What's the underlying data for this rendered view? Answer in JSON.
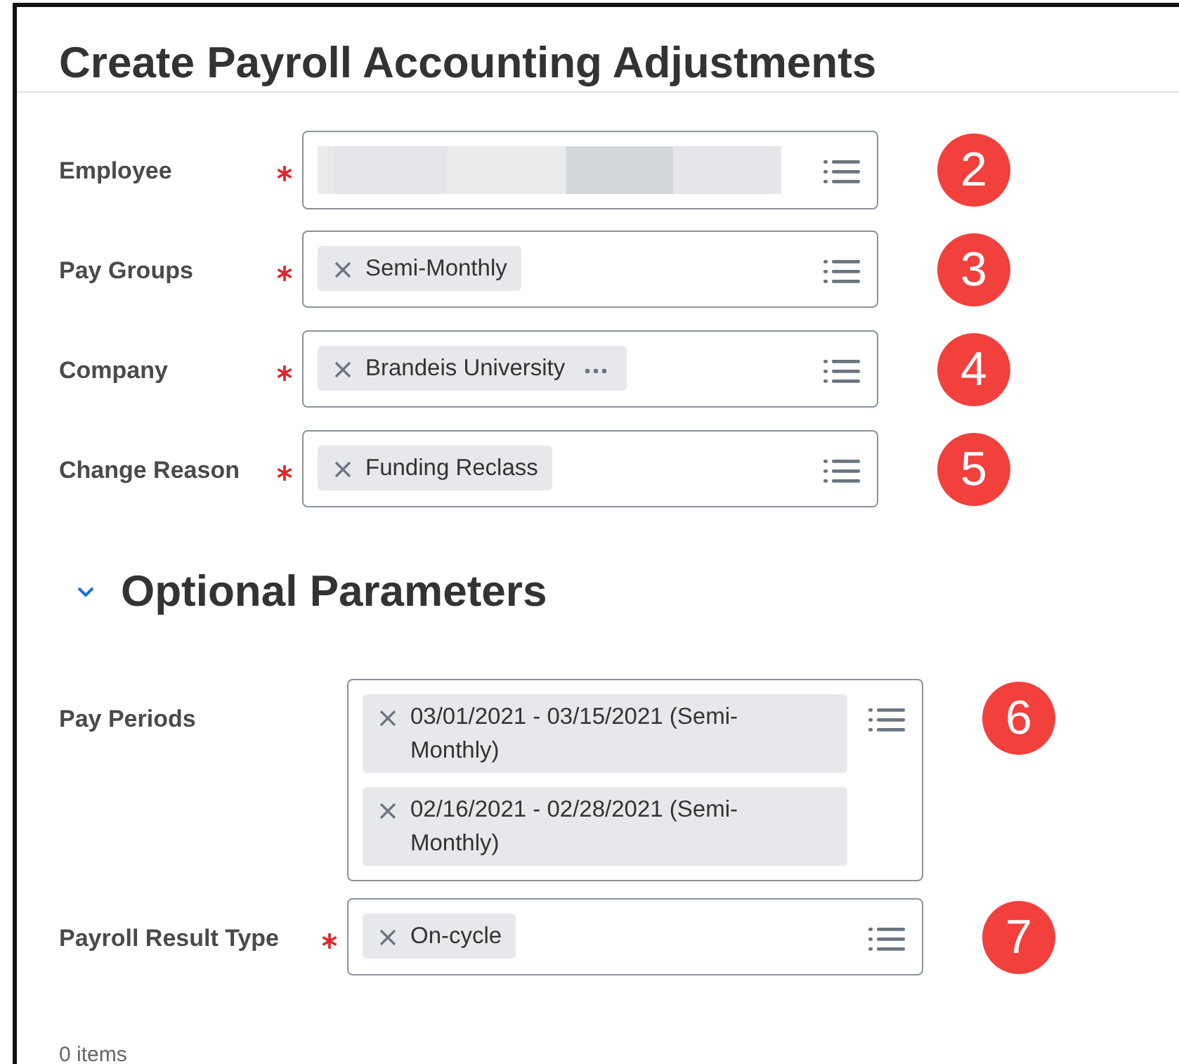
{
  "title": "Create Payroll Accounting Adjustments",
  "fields": [
    {
      "label": "Employee",
      "required": true,
      "kind": "redacted",
      "badge": "2"
    },
    {
      "label": "Pay Groups",
      "required": true,
      "kind": "chips",
      "chips": [
        {
          "text": "Semi-Monthly",
          "related_actions": false
        }
      ],
      "badge": "3"
    },
    {
      "label": "Company",
      "required": true,
      "kind": "chips",
      "chips": [
        {
          "text": "Brandeis University",
          "related_actions": true
        }
      ],
      "badge": "4"
    },
    {
      "label": "Change Reason",
      "required": true,
      "kind": "chips",
      "chips": [
        {
          "text": "Funding Reclass",
          "related_actions": false
        }
      ],
      "badge": "5"
    }
  ],
  "section": {
    "title": "Optional Parameters",
    "expanded": true,
    "fields": [
      {
        "label": "Pay Periods",
        "required": false,
        "kind": "chips",
        "chips": [
          {
            "text": "03/01/2021 - 03/15/2021 (Semi-Monthly)",
            "related_actions": false
          },
          {
            "text": "02/16/2021 - 02/28/2021 (Semi-Monthly)",
            "related_actions": false
          }
        ],
        "badge": "6"
      },
      {
        "label": "Payroll Result Type",
        "required": true,
        "kind": "chips",
        "chips": [
          {
            "text": "On-cycle",
            "related_actions": false
          }
        ],
        "badge": "7"
      }
    ]
  },
  "footer": "0 items"
}
